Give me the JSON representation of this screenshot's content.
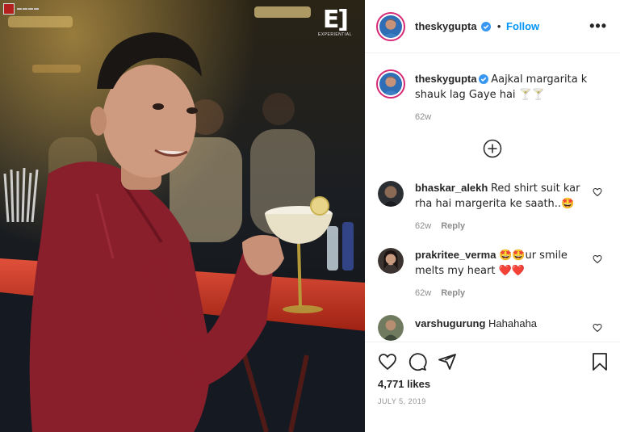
{
  "post_header": {
    "username": "theskygupta",
    "follow_label": "Follow",
    "more_label": "•••"
  },
  "caption": {
    "username": "theskygupta",
    "text": "Aajkal margarita k shauk lag Gaye hai 🍸🍸",
    "time": "62w"
  },
  "comments": [
    {
      "username": "bhaskar_alekh",
      "text": "Red shirt suit kar rha hai margerita ke saath..🤩",
      "time": "62w",
      "reply_label": "Reply"
    },
    {
      "username": "prakritee_verma",
      "text": "🤩🤩ur smile melts my heart ❤️❤️",
      "time": "62w",
      "reply_label": "Reply"
    },
    {
      "username": "varshugurung",
      "text": "Hahahaha"
    }
  ],
  "footer": {
    "likes": "4,771 likes",
    "date": "JULY 5, 2019"
  },
  "watermark": {
    "logo_text": "E]",
    "logo_sub": "EXPERIENTIAL"
  },
  "icons": {
    "header_verified": "verified-badge-icon",
    "add_comments": "plus-circle-icon",
    "like": "heart-outline-icon",
    "comment": "speech-bubble-icon",
    "share": "paper-plane-icon",
    "save": "bookmark-icon"
  },
  "colors": {
    "verified": "#3897f0",
    "link": "#0095f6",
    "muted": "#8e8e8e",
    "heart": "#ed4956",
    "shirt": "#8a1f2c"
  }
}
